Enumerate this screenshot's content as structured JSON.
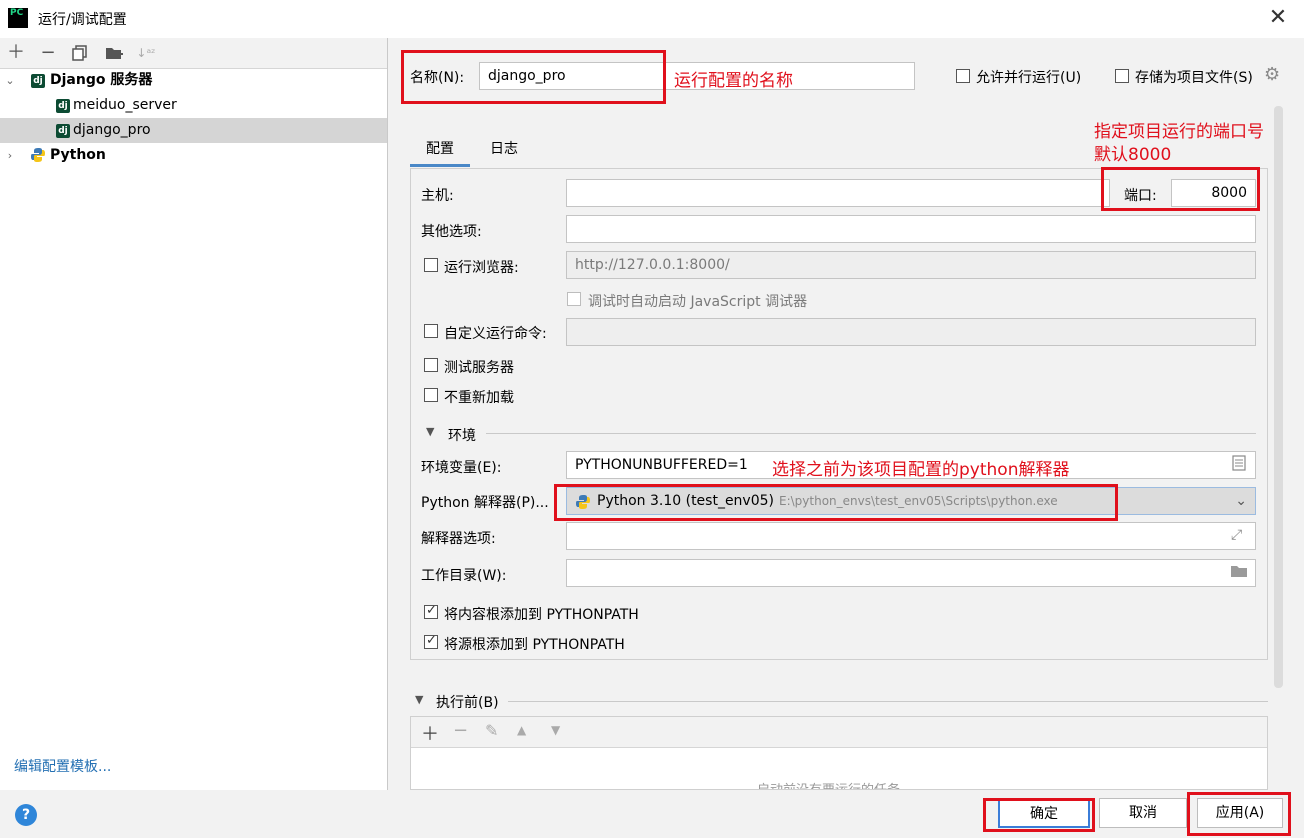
{
  "window": {
    "title": "运行/调试配置"
  },
  "tree": {
    "django_group": "Django 服务器",
    "items": [
      "meiduo_server",
      "django_pro"
    ],
    "python_group": "Python",
    "dj_badge": "dj"
  },
  "edit_templates_link": "编辑配置模板...",
  "form": {
    "name_label": "名称(N):",
    "name_value": "django_pro",
    "allow_parallel_label": "允许并行运行(U)",
    "store_as_file_label": "存储为项目文件(S)",
    "tabs": [
      "配置",
      "日志"
    ],
    "host_label": "主机:",
    "port_label": "端口:",
    "port_value": "8000",
    "other_options_label": "其他选项:",
    "run_browser_label": "运行浏览器:",
    "browser_url": "http://127.0.0.1:8000/",
    "js_debug_label": "调试时自动启动 JavaScript 调试器",
    "custom_cmd_label": "自定义运行命令:",
    "test_server_label": "测试服务器",
    "no_reload_label": "不重新加载",
    "env_section": "环境",
    "env_vars_label": "环境变量(E):",
    "env_vars_value": "PYTHONUNBUFFERED=1",
    "interpreter_label": "Python 解释器(P)...",
    "interpreter_value": "Python 3.10 (test_env05)",
    "interpreter_path": "E:\\python_envs\\test_env05\\Scripts\\python.exe",
    "interp_options_label": "解释器选项:",
    "workdir_label": "工作目录(W):",
    "add_content_roots_label": "将内容根添加到 PYTHONPATH",
    "add_source_roots_label": "将源根添加到 PYTHONPATH",
    "before_launch_label": "执行前(B)",
    "before_launch_empty": "启动前没有要运行的任务"
  },
  "annotations": {
    "name_note": "运行配置的名称",
    "port_note_1": "指定项目运行的端口号",
    "port_note_2": "默认8000",
    "interpreter_note": "选择之前为该项目配置的python解释器"
  },
  "buttons": {
    "ok": "确定",
    "cancel": "取消",
    "apply": "应用(A)",
    "help": "?"
  },
  "icons": {
    "app": "PC"
  },
  "colors": {
    "annotation": "#e0101c",
    "link": "#2470b3",
    "selection": "#d5d5d5"
  }
}
